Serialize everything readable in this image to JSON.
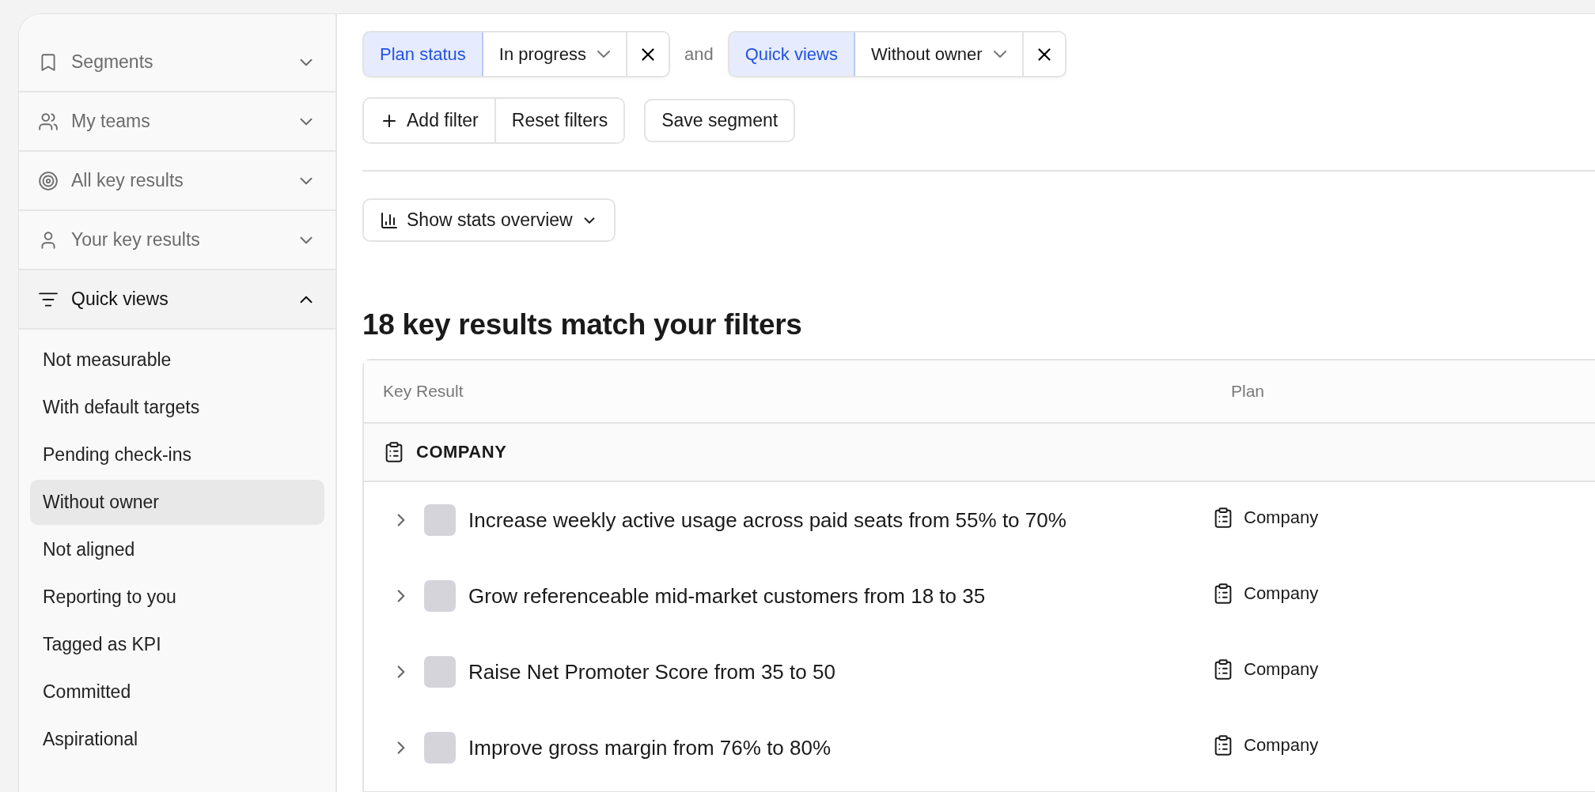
{
  "sidebar": {
    "sections": [
      {
        "label": "Segments",
        "expanded": false
      },
      {
        "label": "My teams",
        "expanded": false
      },
      {
        "label": "All key results",
        "expanded": false
      },
      {
        "label": "Your key results",
        "expanded": false
      },
      {
        "label": "Quick views",
        "expanded": true
      }
    ],
    "quick_views": [
      {
        "label": "Not measurable",
        "selected": false
      },
      {
        "label": "With default targets",
        "selected": false
      },
      {
        "label": "Pending check-ins",
        "selected": false
      },
      {
        "label": "Without owner",
        "selected": true
      },
      {
        "label": "Not aligned",
        "selected": false
      },
      {
        "label": "Reporting to you",
        "selected": false
      },
      {
        "label": "Tagged as KPI",
        "selected": false
      },
      {
        "label": "Committed",
        "selected": false
      },
      {
        "label": "Aspirational",
        "selected": false
      }
    ]
  },
  "filters": [
    {
      "field": "Plan status",
      "value": "In progress"
    },
    {
      "field": "Quick views",
      "value": "Without owner"
    }
  ],
  "filter_joiner": "and",
  "actions": {
    "add": "Add filter",
    "reset": "Reset filters",
    "save": "Save segment"
  },
  "stats_button": "Show stats overview",
  "heading": "18 key results match your filters",
  "table": {
    "columns": [
      "Key Result",
      "Plan"
    ],
    "group": "COMPANY",
    "rows": [
      {
        "title": "Increase weekly active usage across paid seats from 55% to 70%",
        "plan": "Company",
        "expanded": false
      },
      {
        "title": "Grow referenceable mid-market customers from 18 to 35",
        "plan": "Company",
        "expanded": false
      },
      {
        "title": "Raise Net Promoter Score from 35 to 50",
        "plan": "Company",
        "expanded": false
      },
      {
        "title": "Improve gross margin from 76% to 80%",
        "plan": "Company",
        "expanded": false
      }
    ]
  }
}
